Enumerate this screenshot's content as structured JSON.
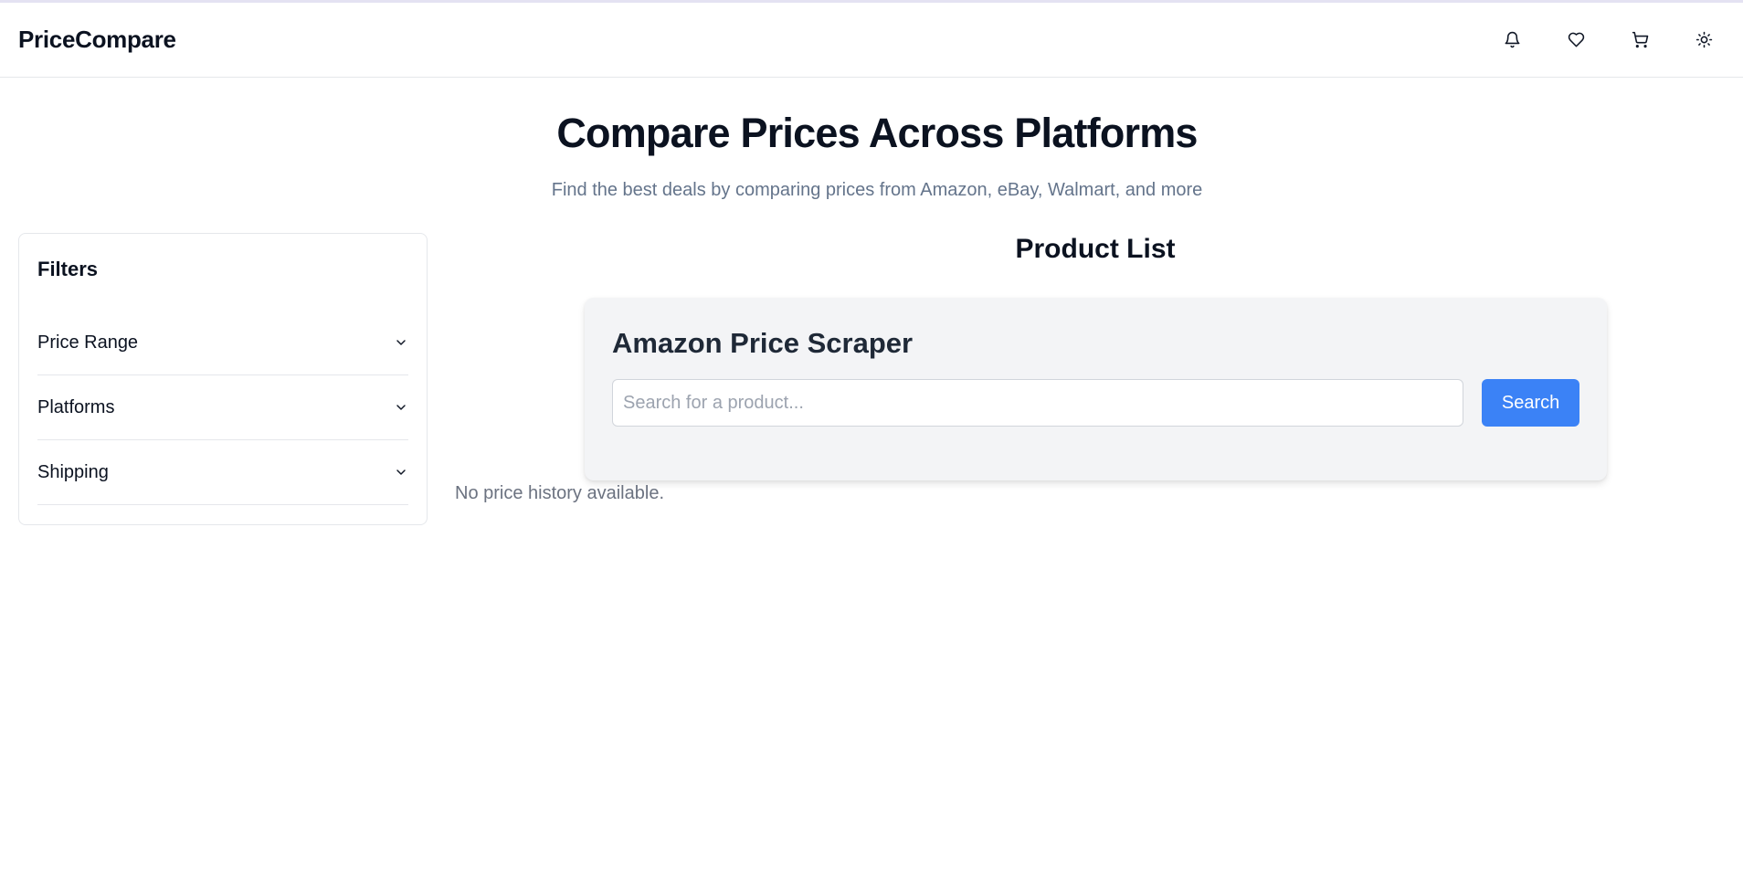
{
  "header": {
    "brand": "PriceCompare",
    "icons": [
      "bell-icon",
      "heart-icon",
      "cart-icon",
      "sun-icon"
    ]
  },
  "hero": {
    "title": "Compare Prices Across Platforms",
    "subtitle": "Find the best deals by comparing prices from Amazon, eBay, Walmart, and more"
  },
  "filters": {
    "title": "Filters",
    "items": [
      {
        "label": "Price Range"
      },
      {
        "label": "Platforms"
      },
      {
        "label": "Shipping"
      }
    ]
  },
  "products": {
    "title": "Product List"
  },
  "scraper": {
    "title": "Amazon Price Scraper",
    "search_value": "",
    "search_placeholder": "Search for a product...",
    "search_button": "Search"
  },
  "price_history": {
    "empty_text": "No price history available."
  },
  "colors": {
    "accent": "#3b82f6",
    "muted_text": "#64748b",
    "card_bg": "#f3f4f6",
    "border": "#e5e7eb"
  }
}
